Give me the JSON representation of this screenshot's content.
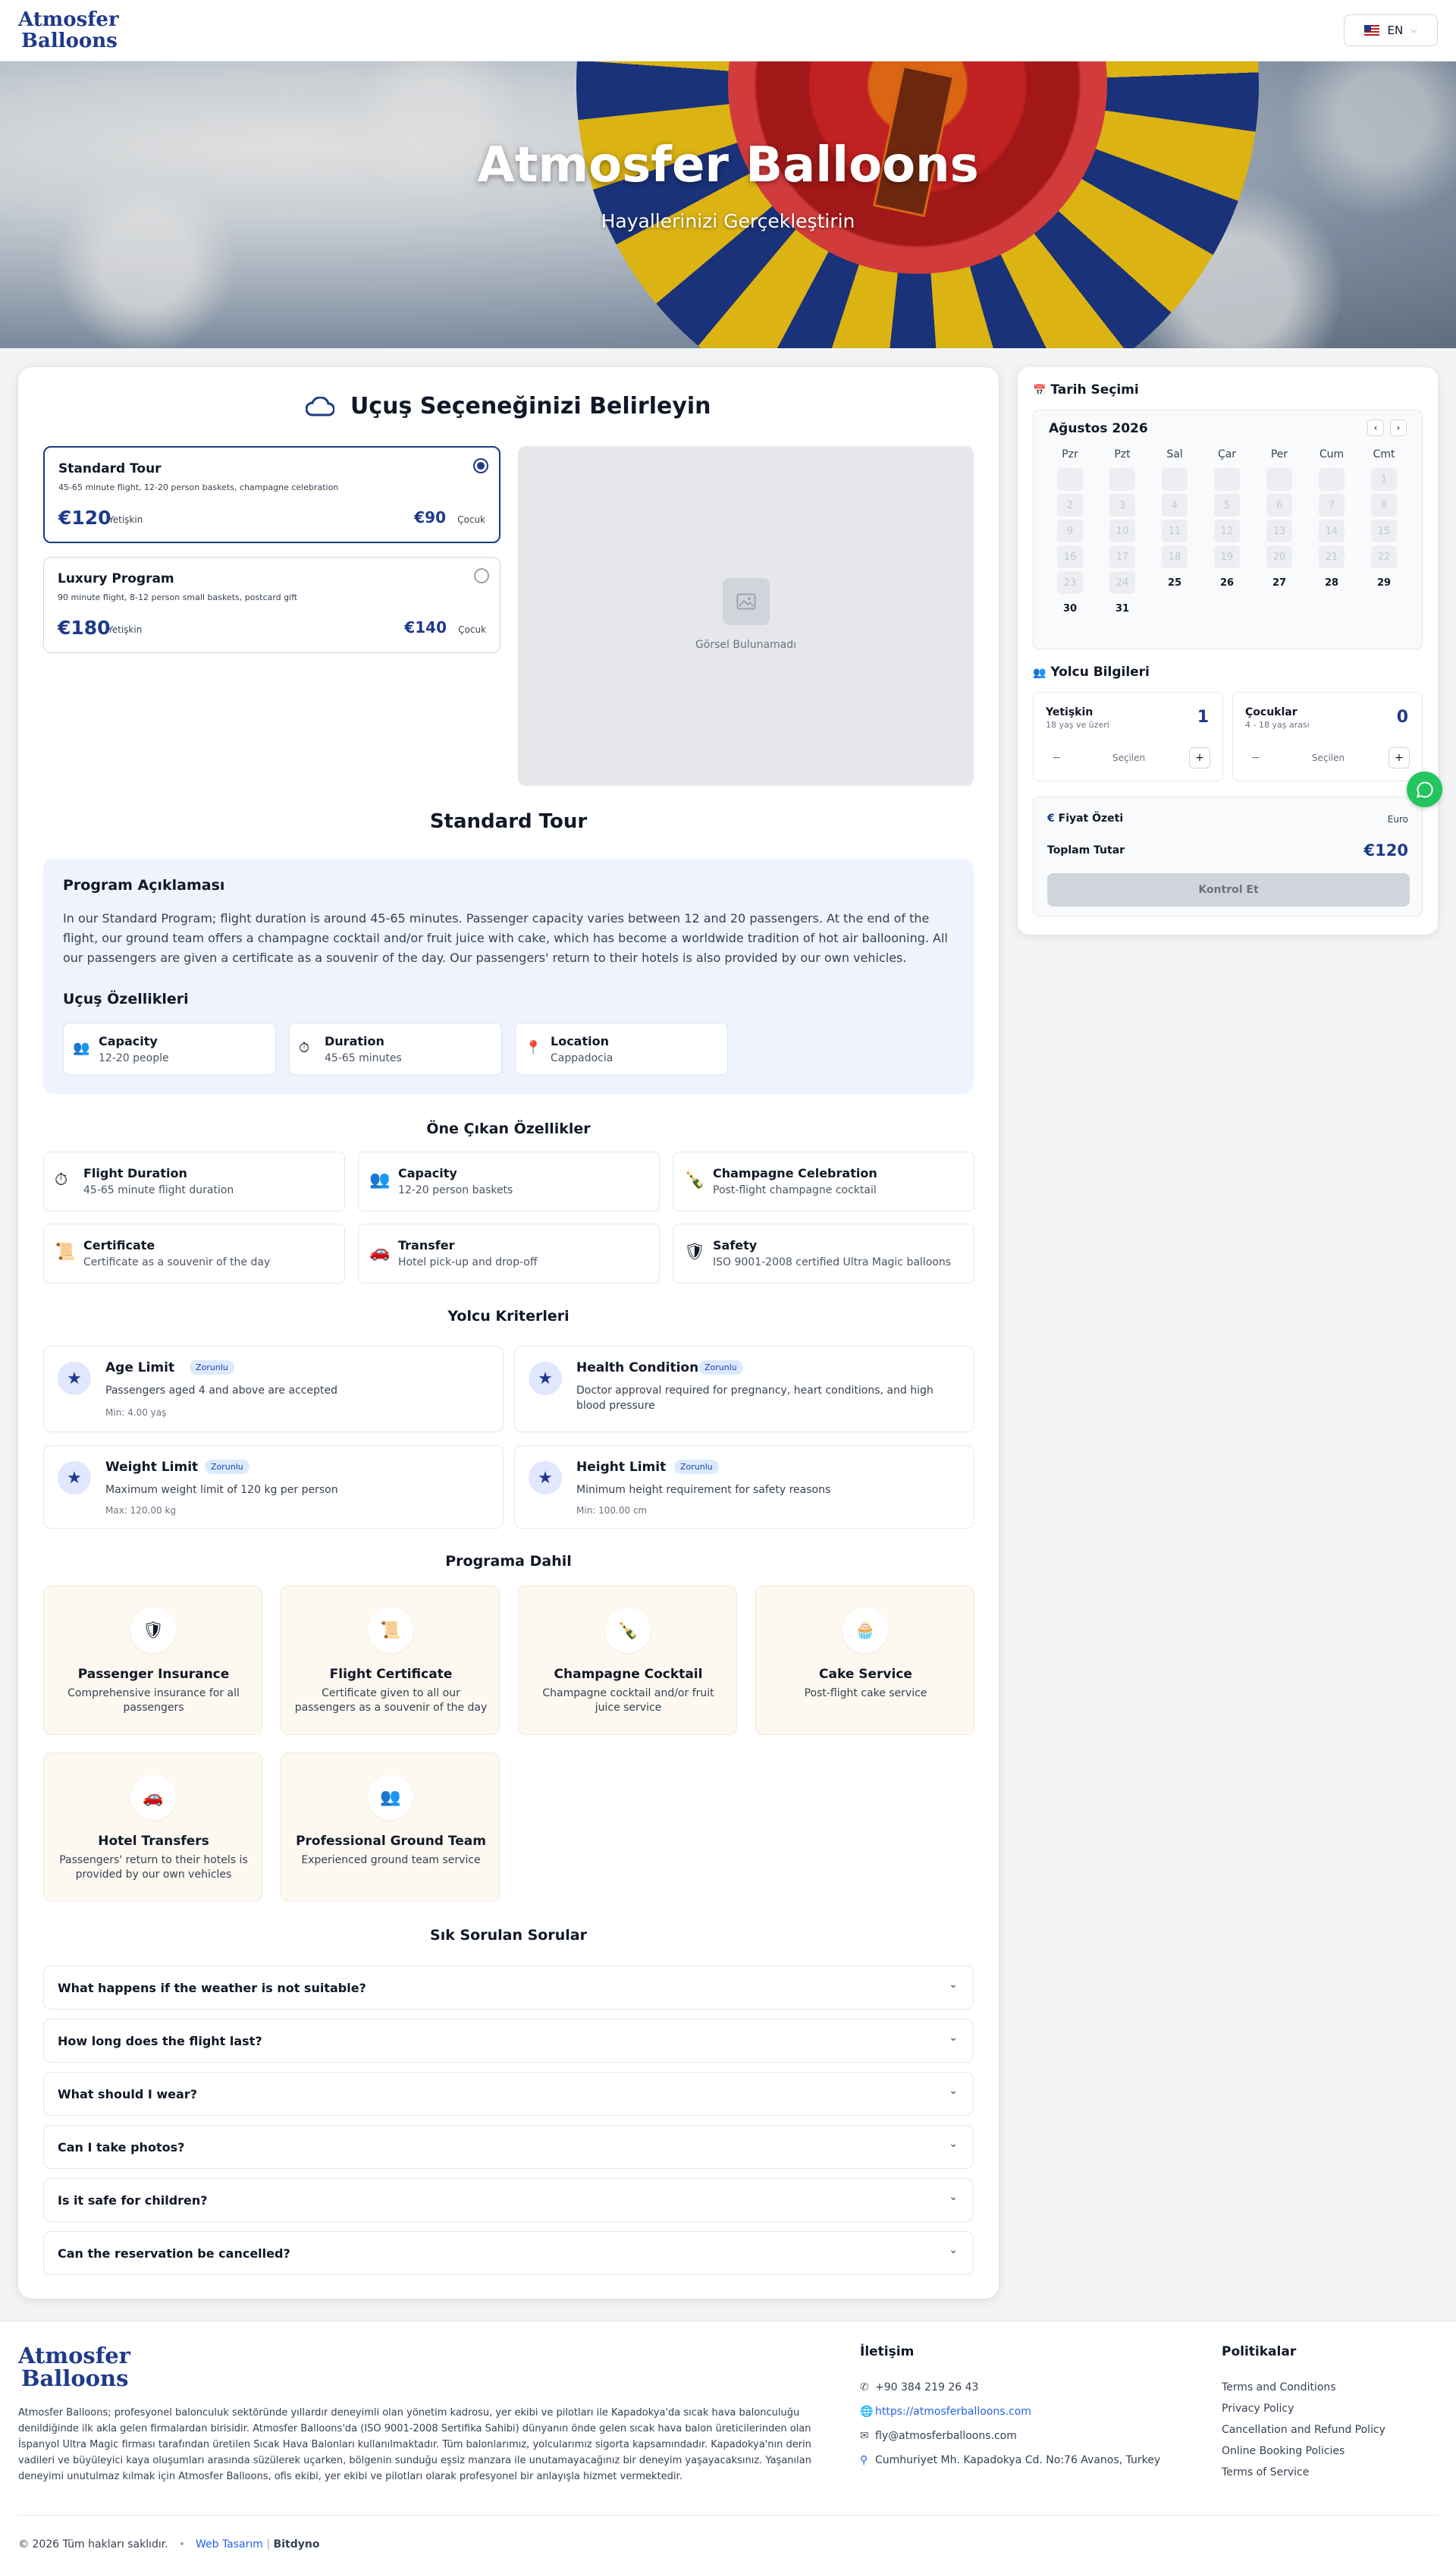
{
  "header": {
    "logo_line1": "Atmosfer",
    "logo_line2": "Balloons",
    "lang": "EN"
  },
  "hero": {
    "title": "Atmosfer Balloons",
    "subtitle": "Hayallerinizi Gerçekleştirin"
  },
  "flight_select": {
    "title": "Uçuş Seçeneğinizi Belirleyin",
    "options": [
      {
        "name": "Standard Tour",
        "desc": "45-65 minute flight, 12-20 person baskets, champagne celebration",
        "adult_price": "€120",
        "adult_label": "Yetişkin",
        "child_price": "€90",
        "child_label": "Çocuk"
      },
      {
        "name": "Luxury Program",
        "desc": "90 minute flight, 8-12 person small baskets, postcard gift",
        "adult_price": "€180",
        "adult_label": "Yetişkin",
        "child_price": "€140",
        "child_label": "Çocuk"
      }
    ],
    "image_placeholder": "Görsel Bulunamadı",
    "selected_title": "Standard Tour"
  },
  "program": {
    "title": "Program Açıklaması",
    "text": "In our Standard Program; flight duration is around 45-65 minutes. Passenger capacity varies between 12 and 20 passengers. At the end of the flight, our ground team offers a champagne cocktail and/or fruit juice with cake, which has become a worldwide tradition of hot air ballooning. All our passengers are given a certificate as a souvenir of the day. Our passengers' return to their hotels is also provided by our own vehicles.",
    "features_title": "Uçuş Özellikleri",
    "features": [
      {
        "icon": "people-icon",
        "title": "Capacity",
        "value": "12-20 people"
      },
      {
        "icon": "stopwatch-icon",
        "title": "Duration",
        "value": "45-65 minutes"
      },
      {
        "icon": "location-pin-icon",
        "title": "Location",
        "value": "Cappadocia"
      }
    ]
  },
  "highlights": {
    "title": "Öne Çıkan Özellikler",
    "items": [
      {
        "icon": "stopwatch-icon",
        "title": "Flight Duration",
        "desc": "45-65 minute flight duration"
      },
      {
        "icon": "people-icon",
        "title": "Capacity",
        "desc": "12-20 person baskets"
      },
      {
        "icon": "champagne-icon",
        "title": "Champagne Celebration",
        "desc": "Post-flight champagne cocktail"
      },
      {
        "icon": "scroll-icon",
        "title": "Certificate",
        "desc": "Certificate as a souvenir of the day"
      },
      {
        "icon": "car-icon",
        "title": "Transfer",
        "desc": "Hotel pick-up and drop-off"
      },
      {
        "icon": "shield-icon",
        "title": "Safety",
        "desc": "ISO 9001-2008 certified Ultra Magic balloons"
      }
    ]
  },
  "criteria": {
    "title": "Yolcu Kriterleri",
    "items": [
      {
        "title": "Age Limit",
        "badge": "Zorunlu",
        "desc": "Passengers aged 4 and above are accepted",
        "meta": "Min: 4.00 yaş"
      },
      {
        "title": "Health Condition",
        "badge": "Zorunlu",
        "desc": "Doctor approval required for pregnancy, heart conditions, and high blood pressure",
        "meta": ""
      },
      {
        "title": "Weight Limit",
        "badge": "Zorunlu",
        "desc": "Maximum weight limit of 120 kg per person",
        "meta": "Max: 120.00 kg"
      },
      {
        "title": "Height Limit",
        "badge": "Zorunlu",
        "desc": "Minimum height requirement for safety reasons",
        "meta": "Min: 100.00 cm"
      }
    ]
  },
  "included": {
    "title": "Programa Dahil",
    "items": [
      {
        "icon": "shield-icon",
        "title": "Passenger Insurance",
        "desc": "Comprehensive insurance for all passengers"
      },
      {
        "icon": "scroll-icon",
        "title": "Flight Certificate",
        "desc": "Certificate given to all our passengers as a souvenir of the day"
      },
      {
        "icon": "champagne-icon",
        "title": "Champagne Cocktail",
        "desc": "Champagne cocktail and/or fruit juice service"
      },
      {
        "icon": "cake-icon",
        "title": "Cake Service",
        "desc": "Post-flight cake service"
      },
      {
        "icon": "car-icon",
        "title": "Hotel Transfers",
        "desc": "Passengers' return to their hotels is provided by our own vehicles"
      },
      {
        "icon": "people-icon",
        "title": "Professional Ground Team",
        "desc": "Experienced ground team service"
      }
    ]
  },
  "faq": {
    "title": "Sık Sorulan Sorular",
    "items": [
      "What happens if the weather is not suitable?",
      "How long does the flight last?",
      "What should I wear?",
      "Can I take photos?",
      "Is it safe for children?",
      "Can the reservation be cancelled?"
    ]
  },
  "sidebar": {
    "date_title": "Tarih Seçimi",
    "month": "Ağustos 2026",
    "weekdays": [
      "Pzr",
      "Pzt",
      "Sal",
      "Çar",
      "Per",
      "Cum",
      "Cmt"
    ],
    "days": [
      "",
      "",
      "",
      "",
      "",
      "",
      "1",
      "2",
      "3",
      "4",
      "5",
      "6",
      "7",
      "8",
      "9",
      "10",
      "11",
      "12",
      "13",
      "14",
      "15",
      "16",
      "17",
      "18",
      "19",
      "20",
      "21",
      "22",
      "23",
      "24",
      "25",
      "26",
      "27",
      "28",
      "29",
      "30",
      "31"
    ],
    "first_available_day": 25,
    "passenger_title": "Yolcu Bilgileri",
    "adult": {
      "label": "Yetişkin",
      "sub": "18 yaş ve üzeri",
      "count": "1",
      "select_label": "Seçilen"
    },
    "child": {
      "label": "Çocuklar",
      "sub": "4 - 18 yaş arası",
      "count": "0",
      "select_label": "Seçilen"
    },
    "price_title": "Fiyat Özeti",
    "currency": "Euro",
    "total_label": "Toplam Tutar",
    "total_value": "€120",
    "check_button": "Kontrol Et"
  },
  "footer": {
    "logo_line1": "Atmosfer",
    "logo_line2": "Balloons",
    "about": "Atmosfer Balloons; profesyonel balonculuk sektöründe yıllardır deneyimli olan yönetim kadrosu, yer ekibi ve pilotları ile Kapadokya'da sıcak hava balonculuğu denildiğinde ilk akla gelen firmalardan birisidir. Atmosfer Balloons'da (ISO 9001-2008 Sertifika Sahibi) dünyanın önde gelen sıcak hava balon üreticilerinden olan İspanyol Ultra Magic firması tarafından üretilen Sıcak Hava Balonları kullanılmaktadır. Tüm balonlarımız, yolcularımız sigorta kapsamındadır. Kapadokya'nın derin vadileri ve büyüleyici kaya oluşumları arasında süzülerek uçarken, bölgenin sunduğu eşsiz manzara ile unutamayacağınız bir deneyim yaşayacaksınız. Yaşanılan deneyimi unutulmaz kılmak için Atmosfer Balloons, ofis ekibi, yer ekibi ve pilotları olarak profesyonel bir anlayışla hizmet vermektedir.",
    "contact_title": "İletişim",
    "phone": "+90 384 219 26 43",
    "website": "https://atmosferballoons.com",
    "email": "fly@atmosferballoons.com",
    "address": "Cumhuriyet Mh. Kapadokya Cd. No:76 Avanos, Turkey",
    "policies_title": "Politikalar",
    "policies": [
      "Terms and Conditions",
      "Privacy Policy",
      "Cancellation and Refund Policy",
      "Online Booking Policies",
      "Terms of Service"
    ],
    "copyright": "© 2026 Tüm hakları saklıdır.",
    "separator": "•",
    "web_design_label": "Web Tasarım",
    "pipe": "|",
    "brand": "Bitdyno"
  }
}
